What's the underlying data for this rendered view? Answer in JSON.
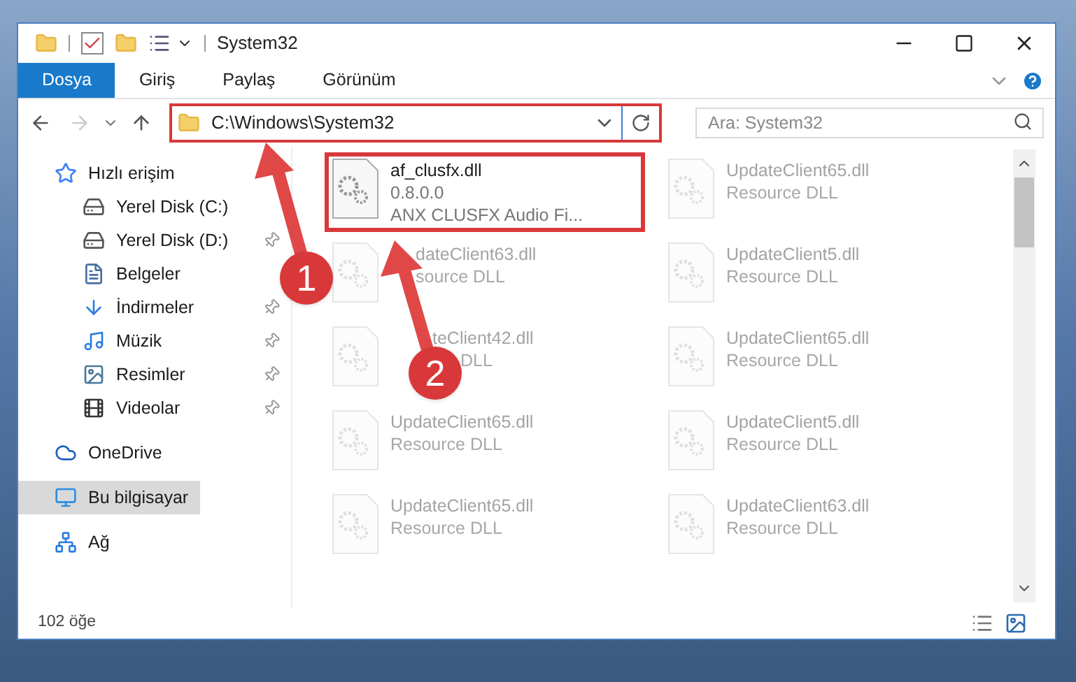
{
  "window": {
    "title": "System32"
  },
  "ribbon_tabs": [
    {
      "label": "Dosya",
      "selected": true
    },
    {
      "label": "Giriş",
      "selected": false
    },
    {
      "label": "Paylaş",
      "selected": false
    },
    {
      "label": "Görünüm",
      "selected": false
    }
  ],
  "address": {
    "path": "C:\\Windows\\System32"
  },
  "search": {
    "placeholder": "Ara: System32"
  },
  "sidebar": {
    "items": [
      {
        "label": "Hızlı erişim",
        "kind": "star",
        "selected": false,
        "children": [
          {
            "label": "Yerel Disk (C:)",
            "kind": "drive-c",
            "selected": false,
            "pinned": false
          },
          {
            "label": "Yerel Disk (D:)",
            "kind": "drive",
            "selected": false,
            "pinned": true
          },
          {
            "label": "Belgeler",
            "kind": "document",
            "selected": false,
            "pinned": false
          },
          {
            "label": "İndirmeler",
            "kind": "download",
            "selected": false,
            "pinned": true
          },
          {
            "label": "Müzik",
            "kind": "music",
            "selected": false,
            "pinned": true
          },
          {
            "label": "Resimler",
            "kind": "picture",
            "selected": false,
            "pinned": true
          },
          {
            "label": "Videolar",
            "kind": "film",
            "selected": false,
            "pinned": true
          }
        ]
      },
      {
        "label": "OneDrive",
        "kind": "cloud",
        "selected": false
      },
      {
        "label": "Bu bilgisayar",
        "kind": "computer",
        "selected": true
      },
      {
        "label": "Ağ",
        "kind": "network",
        "selected": false
      }
    ]
  },
  "files": [
    {
      "name": "af_clusfx.dll",
      "lines": [
        "0.8.0.0",
        "ANX CLUSFX Audio Fi..."
      ],
      "faded": false,
      "highlighted": true
    },
    {
      "name": "UpdateClient65.dll",
      "lines": [
        "Resource DLL"
      ],
      "faded": true,
      "highlighted": false
    },
    {
      "kind": "behind-arrow",
      "name": "dateClient63.dll",
      "lines": [
        "source DLL"
      ],
      "faded": true,
      "highlighted": false
    },
    {
      "name": "UpdateClient5.dll",
      "lines": [
        "Resource DLL"
      ],
      "faded": true,
      "highlighted": false
    },
    {
      "kind": "behind-badge",
      "name": "teClient42.dll",
      "lines": [
        "DLL"
      ],
      "faded": true,
      "highlighted": false
    },
    {
      "name": "UpdateClient65.dll",
      "lines": [
        "Resource DLL"
      ],
      "faded": true,
      "highlighted": false
    },
    {
      "name": "UpdateClient65.dll",
      "lines": [
        "Resource DLL"
      ],
      "faded": true,
      "highlighted": false
    },
    {
      "name": "UpdateClient5.dll",
      "lines": [
        "Resource DLL"
      ],
      "faded": true,
      "highlighted": false
    },
    {
      "name": "UpdateClient65.dll",
      "lines": [
        "Resource DLL"
      ],
      "faded": true,
      "highlighted": false
    },
    {
      "name": "UpdateClient63.dll",
      "lines": [
        "Resource DLL"
      ],
      "faded": true,
      "highlighted": false
    }
  ],
  "status_bar": {
    "count": "102 öğe"
  },
  "callouts": [
    {
      "label": "1"
    },
    {
      "label": "2"
    }
  ]
}
